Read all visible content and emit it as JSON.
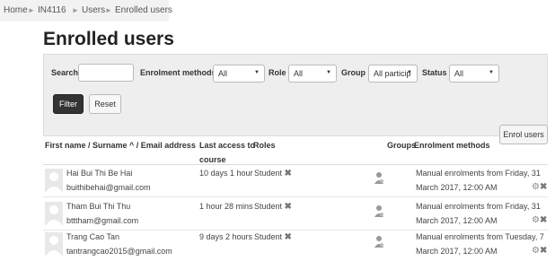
{
  "breadcrumb": {
    "items": [
      "Home",
      "IN4116",
      "Users",
      "Enrolled users"
    ],
    "separator": "►"
  },
  "page": {
    "title": "Enrolled users"
  },
  "filters": {
    "search_label": "Search",
    "search_value": "",
    "enrolment_methods_label": "Enrolment methods",
    "enrolment_methods_value": "All",
    "role_label": "Role",
    "role_value": "All",
    "group_label": "Group",
    "group_value": "All particip",
    "status_label": "Status",
    "status_value": "All",
    "filter_button": "Filter",
    "reset_button": "Reset"
  },
  "enrol_button": "Enrol users",
  "table": {
    "headers": {
      "name": "First name / Surname ^ / Email address",
      "last_access_1": "Last access to",
      "last_access_2": "course",
      "roles": "Roles",
      "groups": "Groups",
      "enrolment_methods": "Enrolment methods"
    },
    "rows": [
      {
        "name": "Hai Bui Thi Be Hai",
        "email": "buithibehai@gmail.com",
        "last_access": "10 days 1 hour",
        "role": "Student",
        "enrol_line1": "Manual enrolments from Friday, 31",
        "enrol_line2": "March 2017, 12:00 AM"
      },
      {
        "name": "Tham Bui Thi Thu",
        "email": "btttham@gmail.com",
        "last_access": "1 hour 28 mins",
        "role": "Student",
        "enrol_line1": "Manual enrolments from Friday, 31",
        "enrol_line2": "March 2017, 12:00 AM"
      },
      {
        "name": "Trang Cao Tan",
        "email": "tantrangcao2015@gmail.com",
        "last_access": "9 days 2 hours",
        "role": "Student",
        "enrol_line1": "Manual enrolments from Tuesday, 7",
        "enrol_line2": "March 2017, 12:00 AM"
      }
    ]
  },
  "icons": {
    "remove": "✖",
    "gear": "⚙",
    "user_group": "person-icon",
    "avatar": "default-avatar"
  },
  "colors": {
    "filter_button_bg": "#333333",
    "filter_panel_bg": "#eeeeee",
    "breadcrumb_bg": "#f2f2f2"
  }
}
